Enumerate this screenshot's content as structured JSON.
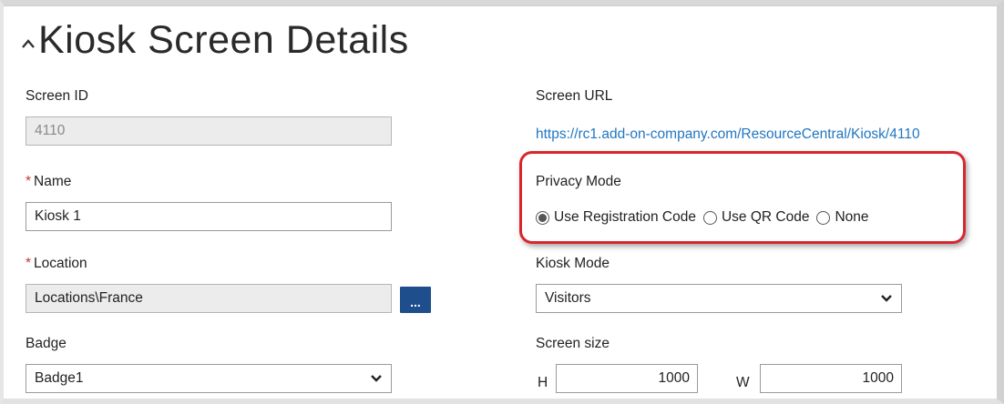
{
  "header": {
    "title": "Kiosk Screen Details",
    "collapse_icon": "chevron-up-icon"
  },
  "left": {
    "screen_id": {
      "label": "Screen ID",
      "value": "4110"
    },
    "name": {
      "required_mark": "*",
      "label": "Name",
      "value": "Kiosk 1"
    },
    "location": {
      "required_mark": "*",
      "label": "Location",
      "value": "Locations\\France",
      "browse_label": "..."
    },
    "badge": {
      "label": "Badge",
      "selected": "Badge1"
    }
  },
  "right": {
    "screen_url": {
      "label": "Screen URL",
      "url": "https://rc1.add-on-company.com/ResourceCentral/Kiosk/4110"
    },
    "privacy_mode": {
      "label": "Privacy Mode",
      "options": [
        {
          "label": "Use Registration Code",
          "checked": true
        },
        {
          "label": "Use QR Code",
          "checked": false
        },
        {
          "label": "None",
          "checked": false
        }
      ],
      "highlight_color": "#d9262e"
    },
    "kiosk_mode": {
      "label": "Kiosk Mode",
      "selected": "Visitors"
    },
    "screen_size": {
      "label": "Screen size",
      "h_label": "H",
      "h_value": "1000",
      "w_label": "W",
      "w_value": "1000"
    }
  },
  "colors": {
    "link": "#1f76c2",
    "button": "#1f4e8c",
    "required": "#c0392b"
  }
}
